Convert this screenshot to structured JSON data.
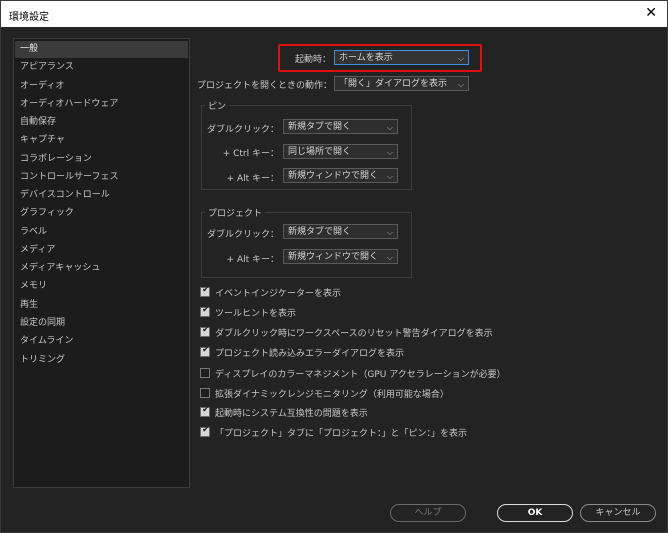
{
  "window": {
    "title": "環境設定"
  },
  "sidebar": {
    "items": [
      {
        "label": "一般"
      },
      {
        "label": "アピアランス"
      },
      {
        "label": "オーディオ"
      },
      {
        "label": "オーディオハードウェア"
      },
      {
        "label": "自動保存"
      },
      {
        "label": "キャプチャ"
      },
      {
        "label": "コラボレーション"
      },
      {
        "label": "コントロールサーフェス"
      },
      {
        "label": "デバイスコントロール"
      },
      {
        "label": "グラフィック"
      },
      {
        "label": "ラベル"
      },
      {
        "label": "メディア"
      },
      {
        "label": "メディアキャッシュ"
      },
      {
        "label": "メモリ"
      },
      {
        "label": "再生"
      },
      {
        "label": "設定の同期"
      },
      {
        "label": "タイムライン"
      },
      {
        "label": "トリミング"
      }
    ],
    "selected": 0
  },
  "general": {
    "startup_label": "起動時：",
    "startup_value": "ホームを表示",
    "open_project_label": "プロジェクトを開くときの動作：",
    "open_project_value": "「開く」ダイアログを表示",
    "pin_group": {
      "title": "ピン",
      "double_click_label": "ダブルクリック：",
      "double_click_value": "新規タブで開く",
      "ctrl_label": "+ Ctrl キー：",
      "ctrl_value": "同じ場所で開く",
      "alt_label": "+ Alt キー：",
      "alt_value": "新規ウィンドウで開く"
    },
    "project_group": {
      "title": "プロジェクト",
      "double_click_label": "ダブルクリック：",
      "double_click_value": "新規タブで開く",
      "alt_label": "+ Alt キー：",
      "alt_value": "新規ウィンドウで開く"
    },
    "checkboxes": [
      {
        "label": "イベントインジケーターを表示",
        "checked": true
      },
      {
        "label": "ツールヒントを表示",
        "checked": true
      },
      {
        "label": "ダブルクリック時にワークスペースのリセット警告ダイアログを表示",
        "checked": true
      },
      {
        "label": "プロジェクト読み込みエラーダイアログを表示",
        "checked": true
      },
      {
        "label": "ディスプレイのカラーマネジメント（GPU アクセラレーションが必要）",
        "checked": false
      },
      {
        "label": "拡張ダイナミックレンジモニタリング（利用可能な場合）",
        "checked": false
      },
      {
        "label": "起動時にシステム互換性の問題を表示",
        "checked": true
      },
      {
        "label": "「プロジェクト」タブに「プロジェクト：」と「ピン：」を表示",
        "checked": true
      }
    ]
  },
  "buttons": {
    "help": "ヘルプ",
    "ok": "OK",
    "cancel": "キャンセル"
  },
  "colors": {
    "accent_focus": "#3c8ee6",
    "highlight": "#e01010"
  }
}
